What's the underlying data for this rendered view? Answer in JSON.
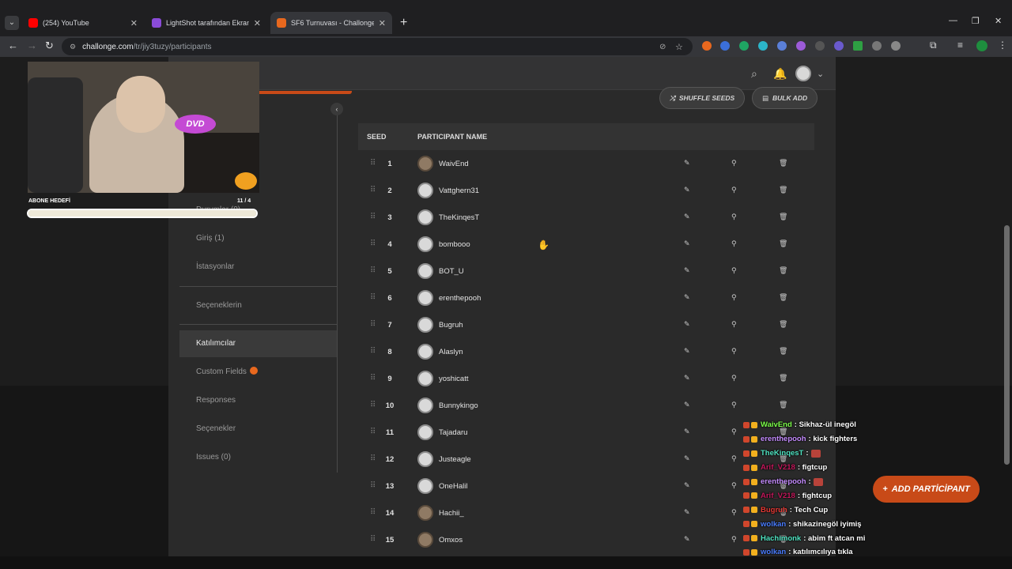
{
  "browser": {
    "tabs": [
      {
        "title": "(254) YouTube",
        "color": "#ff0000"
      },
      {
        "title": "LightShot tarafından Ekran Gör",
        "color": "#8a4bd8"
      },
      {
        "title": "SF6 Turnuvası - Challonge",
        "color": "#e8681e"
      }
    ],
    "new_tab": "+",
    "url_host": "challonge.com",
    "url_path": "/tr/jiy3tuzy/participants"
  },
  "toolbar": {
    "shuffle_label": "SHUFFLE SEEDS",
    "bulk_label": "BULK ADD"
  },
  "sidebar": {
    "items": [
      {
        "label": "...esi"
      },
      {
        "label": "Durumlar (0)"
      },
      {
        "label": "Giriş (1)"
      },
      {
        "label": "İstasyonlar"
      },
      {
        "label": "Seçeneklerin"
      },
      {
        "label": "Katılımcılar"
      },
      {
        "label": "Custom Fields"
      },
      {
        "label": "Responses"
      },
      {
        "label": "Seçenekler"
      },
      {
        "label": "Issues (0)"
      }
    ]
  },
  "table": {
    "col_seed": "SEED",
    "col_name": "PARTICIPANT NAME",
    "rows": [
      {
        "seed": "1",
        "name": "WaivEnd",
        "photo": true
      },
      {
        "seed": "2",
        "name": "Vattghern31",
        "photo": false
      },
      {
        "seed": "3",
        "name": "TheKinqesT",
        "photo": false
      },
      {
        "seed": "4",
        "name": "bombooo",
        "photo": false
      },
      {
        "seed": "5",
        "name": "BOT_U",
        "photo": false
      },
      {
        "seed": "6",
        "name": "erenthepooh",
        "photo": false
      },
      {
        "seed": "7",
        "name": "Bugruh",
        "photo": false
      },
      {
        "seed": "8",
        "name": "Alaslyn",
        "photo": false
      },
      {
        "seed": "9",
        "name": "yoshicatt",
        "photo": false
      },
      {
        "seed": "10",
        "name": "Bunnykingo",
        "photo": false
      },
      {
        "seed": "11",
        "name": "Tajadaru",
        "photo": false
      },
      {
        "seed": "12",
        "name": "Justeagle",
        "photo": false
      },
      {
        "seed": "13",
        "name": "OneHalil",
        "photo": false
      },
      {
        "seed": "14",
        "name": "Hachii_",
        "photo": true
      },
      {
        "seed": "15",
        "name": "Omxos",
        "photo": true
      }
    ]
  },
  "stream": {
    "dvd_text": "DVD",
    "goal_label": "ABONE HEDEFİ",
    "goal_count": "11 / 4",
    "goal_progress": 1.0
  },
  "chat": [
    {
      "user": "WaivEnd",
      "color": "#7dff4a",
      "msg": ": Sikhaz-ül inegöl"
    },
    {
      "user": "erenthepooh",
      "color": "#c58cff",
      "msg": ": kick fighters"
    },
    {
      "user": "TheKinqesT",
      "color": "#4fe3c1",
      "msg": ":",
      "emote": true
    },
    {
      "user": "Arif_V218",
      "color": "#c2185b",
      "msg": ": figtcup"
    },
    {
      "user": "erenthepooh",
      "color": "#c58cff",
      "msg": ":",
      "emote": true
    },
    {
      "user": "Arif_V218",
      "color": "#c2185b",
      "msg": ": fightcup"
    },
    {
      "user": "Bugruh",
      "color": "#e53935",
      "msg": ": Tech Cup"
    },
    {
      "user": "wolkan",
      "color": "#4a7dff",
      "msg": ": shikazinegöl iyimiş"
    },
    {
      "user": "Hachimonk",
      "color": "#4fe3c1",
      "msg": ": abim ft atcan mi"
    },
    {
      "user": "wolkan",
      "color": "#4a7dff",
      "msg": ": katılımcılıya tıkla"
    }
  ],
  "add_participant_label": "ADD PARTİCİPANT"
}
